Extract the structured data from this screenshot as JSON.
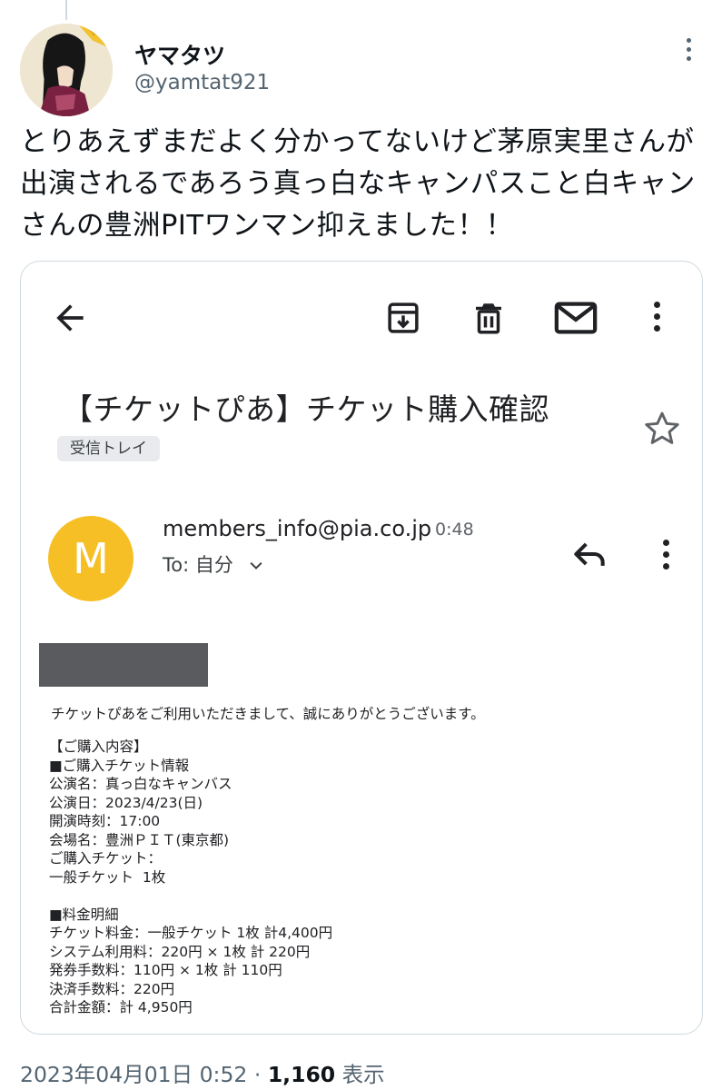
{
  "author": {
    "display_name": "ヤマタツ",
    "handle": "@yamtat921"
  },
  "tweet": {
    "text": "とりあえずまだよく分かってないけど茅原実里さんが\n出演されるであろう真っ白なキャンパスこと白キャン\nさんの豊洲PITワンマン抑えました！！",
    "timestamp": "2023年04月01日 0:52",
    "separator": "·",
    "views_count": "1,160",
    "views_label": "表示"
  },
  "email": {
    "subject": "【チケットぴあ】チケット購入確認",
    "label": "受信トレイ",
    "sender_initial": "M",
    "sender_email": "members_info@pia.co.jp",
    "time": "0:48",
    "recipient": "To: 自分",
    "intro": "チケットぴあをご利用いただきまして、誠にありがとうございます。",
    "lines": [
      "【ご購入内容】",
      "■ご購入チケット情報",
      "公演名：真っ白なキャンバス",
      "公演日：2023/4/23(日)",
      "開演時刻：17:00",
      "会場名：豊洲ＰＩＴ(東京都)",
      "ご購入チケット：",
      "一般チケット  1枚",
      "",
      "■料金明細",
      "チケット料金：一般チケット 1枚 計4,400円",
      "システム利用料：220円 × 1枚 計 220円",
      "発券手数料：110円 × 1枚 計 110円",
      "決済手数料：220円",
      "合計金額：計 4,950円"
    ]
  },
  "icons": {
    "back": "arrow-back-icon",
    "archive": "archive-icon",
    "delete": "trash-icon",
    "mail": "mail-icon",
    "more": "more-vertical-icon",
    "star": "star-icon",
    "reply": "reply-icon",
    "chevron": "chevron-down-icon"
  },
  "colors": {
    "sender_avatar": "#f6bf26",
    "label_chip": "#e8eaed",
    "muted_text": "#536471",
    "redaction": "#5a5b5e"
  }
}
